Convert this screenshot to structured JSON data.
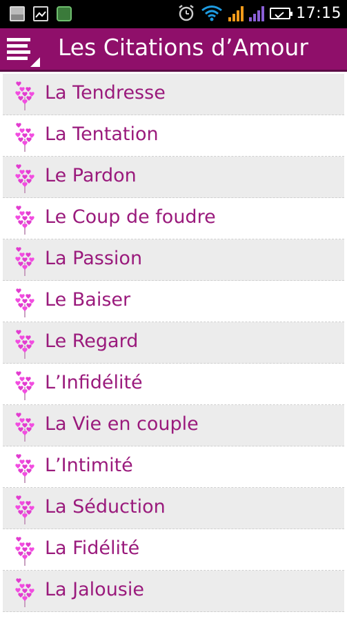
{
  "status_bar": {
    "time": "17:15",
    "icons": [
      "image-notification-icon",
      "gallery-icon",
      "app-notification-icon",
      "alarm-icon",
      "wifi-icon",
      "signal-icon",
      "signal-icon-2",
      "battery-icon"
    ]
  },
  "action_bar": {
    "title": "Les Citations d’Amour",
    "menu_icon": "menu-icon",
    "color": "#8f0f6a"
  },
  "list": {
    "item_icon": "heart-bouquet-icon",
    "text_color": "#9a1a7c",
    "items": [
      {
        "label": "La Tendresse"
      },
      {
        "label": "La Tentation"
      },
      {
        "label": "Le Pardon"
      },
      {
        "label": "Le Coup de foudre"
      },
      {
        "label": "La Passion"
      },
      {
        "label": "Le Baiser"
      },
      {
        "label": "Le Regard"
      },
      {
        "label": "L’Infidélité"
      },
      {
        "label": "La Vie en couple"
      },
      {
        "label": "L’Intimité"
      },
      {
        "label": "La Séduction"
      },
      {
        "label": "La Fidélité"
      },
      {
        "label": "La Jalousie"
      }
    ]
  }
}
